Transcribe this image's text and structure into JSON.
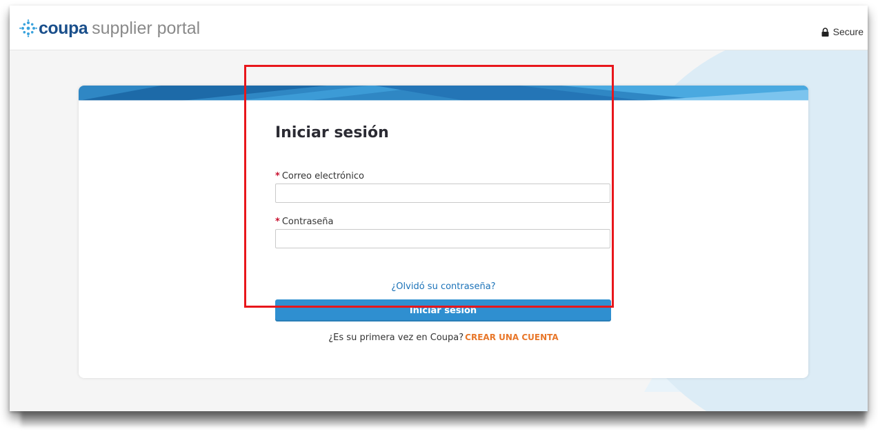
{
  "header": {
    "logo_brand": "coupa",
    "logo_suffix": "supplier portal",
    "secure_label": "Secure"
  },
  "login": {
    "title": "Iniciar sesión",
    "required_mark": "*",
    "email_label": "Correo electrónico",
    "email_value": "",
    "password_label": "Contraseña",
    "password_value": "",
    "forgot_link": "¿Olvidó su contraseña?",
    "submit_label": "Iniciar sesión",
    "signup_prompt": "¿Es su primera vez en Coupa?",
    "signup_link": "CREAR UNA CUENTA"
  },
  "colors": {
    "brand_blue": "#1a4f8b",
    "button_blue": "#2f8fd0",
    "link_blue": "#1b72b8",
    "signup_orange": "#e8772a",
    "required_red": "#c8102e",
    "highlight_red": "#e8161b"
  }
}
